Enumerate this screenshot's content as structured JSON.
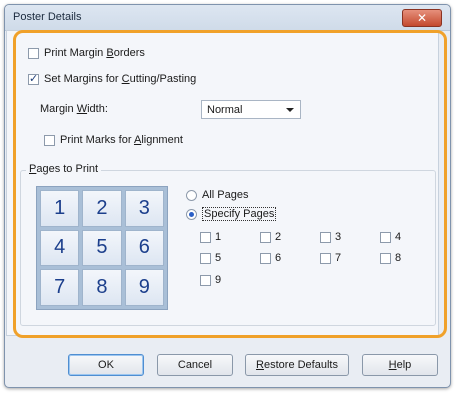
{
  "window": {
    "title": "Poster Details",
    "close_icon": "close-icon"
  },
  "options": {
    "print_margin_borders": {
      "pre": "Print Margin ",
      "key": "B",
      "post": "orders",
      "checked": false
    },
    "set_margins": {
      "pre": "Set Margins for ",
      "key": "C",
      "post": "utting/Pasting",
      "checked": true
    },
    "margin_width": {
      "pre": "Margin ",
      "key": "W",
      "post": "idth:",
      "value": "Normal"
    },
    "print_marks": {
      "pre": "Print Marks for ",
      "key": "A",
      "post": "lignment",
      "checked": false
    }
  },
  "pages_to_print": {
    "label_key": "P",
    "label_post": "ages to Print",
    "grid": [
      "1",
      "2",
      "3",
      "4",
      "5",
      "6",
      "7",
      "8",
      "9"
    ],
    "all_pages": {
      "label": "All Pages",
      "checked": false
    },
    "specify_pages": {
      "label": "Specify Pages",
      "checked": true
    },
    "pages": [
      {
        "label": "1",
        "checked": false
      },
      {
        "label": "2",
        "checked": false
      },
      {
        "label": "3",
        "checked": false
      },
      {
        "label": "4",
        "checked": false
      },
      {
        "label": "5",
        "checked": false
      },
      {
        "label": "6",
        "checked": false
      },
      {
        "label": "7",
        "checked": false
      },
      {
        "label": "8",
        "checked": false
      },
      {
        "label": "9",
        "checked": false
      }
    ]
  },
  "buttons": {
    "ok": "OK",
    "cancel": "Cancel",
    "restore": {
      "key": "R",
      "post": "estore Defaults"
    },
    "help": {
      "key": "H",
      "post": "elp"
    }
  },
  "colors": {
    "highlight": "#f0a12a",
    "grid_text": "#1c3f8c",
    "close": "#c44a2e"
  }
}
